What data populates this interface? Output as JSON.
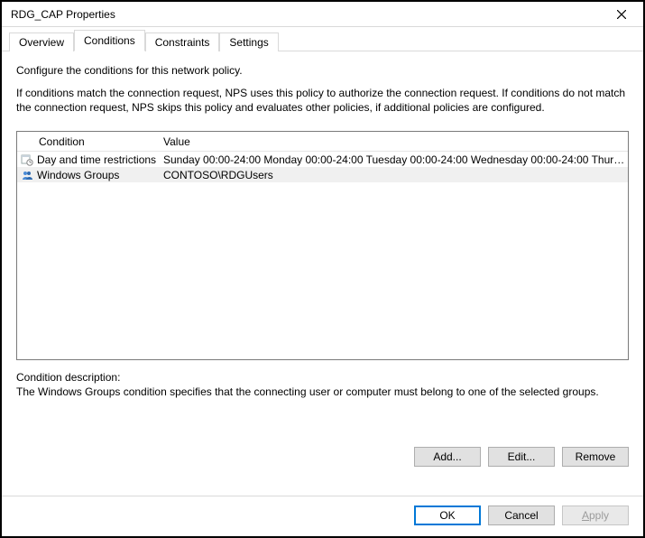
{
  "window": {
    "title": "RDG_CAP Properties"
  },
  "tabs": {
    "overview": "Overview",
    "conditions": "Conditions",
    "constraints": "Constraints",
    "settings": "Settings"
  },
  "intro": {
    "line1": "Configure the conditions for this network policy.",
    "line2": "If conditions match the connection request, NPS uses this policy to authorize the connection request. If conditions do not match the connection request, NPS skips this policy and evaluates other policies, if additional policies are configured."
  },
  "headers": {
    "condition": "Condition",
    "value": "Value"
  },
  "rows": [
    {
      "condition": "Day and time restrictions",
      "value": "Sunday 00:00-24:00 Monday 00:00-24:00 Tuesday 00:00-24:00 Wednesday 00:00-24:00 Thursd...",
      "selected": false,
      "icon": "calendar-clock-icon"
    },
    {
      "condition": "Windows Groups",
      "value": "CONTOSO\\RDGUsers",
      "selected": true,
      "icon": "group-icon"
    }
  ],
  "descLabel": "Condition description:",
  "descText": "The Windows Groups condition specifies that the connecting user or computer must belong to one of the selected groups.",
  "buttons": {
    "add": "Add...",
    "edit": "Edit...",
    "remove": "Remove",
    "ok": "OK",
    "cancel": "Cancel",
    "apply_prefix": "A",
    "apply_rest": "pply"
  }
}
